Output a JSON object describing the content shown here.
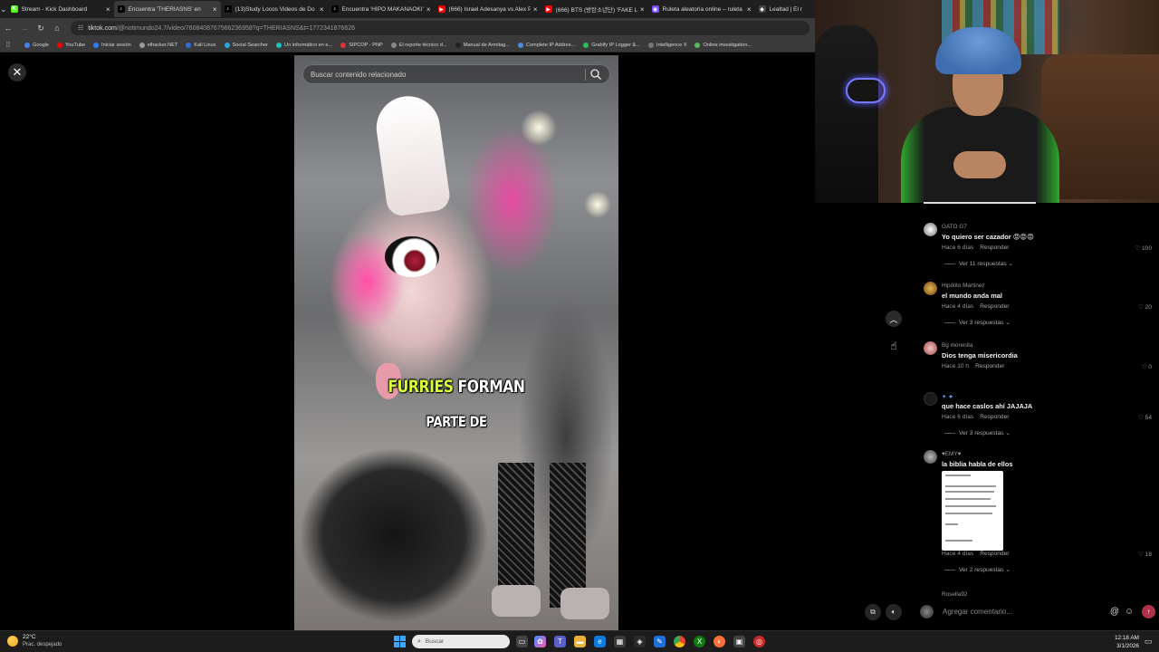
{
  "browser": {
    "tabs": [
      {
        "title": "Stream - Kick Dashboard",
        "favicon": "kick-icon",
        "color": "#53fc18",
        "glyph": "K",
        "active": false
      },
      {
        "title": "Encuentra 'THERIASNS' en",
        "favicon": "tiktok-icon",
        "color": "#000000",
        "glyph": "♪",
        "active": true
      },
      {
        "title": "(13)Study Locos Videos de Do",
        "favicon": "tiktok-icon",
        "color": "#000000",
        "glyph": "♪",
        "active": false
      },
      {
        "title": "Encuentra 'HIPO MAKANAOKI'",
        "favicon": "tiktok-icon",
        "color": "#000000",
        "glyph": "♪",
        "active": false
      },
      {
        "title": "(666) Israel Adesanya vs Alex Pe",
        "favicon": "youtube-icon",
        "color": "#ff0000",
        "glyph": "▶",
        "active": false
      },
      {
        "title": "(666) BTS (방탄소년단) 'FAKE LO",
        "favicon": "youtube-icon",
        "color": "#ff0000",
        "glyph": "▶",
        "active": false
      },
      {
        "title": "Ruleta aleatoria online – ruleta",
        "favicon": "wheel-icon",
        "color": "#7b4bff",
        "glyph": "◉",
        "active": false
      },
      {
        "title": "Lealtad | El r",
        "favicon": "diamond-icon",
        "color": "#444444",
        "glyph": "◆",
        "active": false
      }
    ],
    "address": {
      "domain": "tiktok.com",
      "path": "/@notimundo24.7/video/7608408767566236958?q=THERIASNS&t=1772341876626"
    },
    "bookmarks": [
      {
        "label": "Google",
        "color": "#4285f4"
      },
      {
        "label": "YouTube",
        "color": "#ff0000"
      },
      {
        "label": "Iniciar sesión",
        "color": "#2d7df6"
      },
      {
        "label": "elhacker.NET",
        "color": "#9a9a9a"
      },
      {
        "label": "Kali Linux",
        "color": "#2a6fdb"
      },
      {
        "label": "Social Searcher",
        "color": "#27a8e0"
      },
      {
        "label": "Un informático en e...",
        "color": "#19c2c2"
      },
      {
        "label": "SIPCOP - PNP",
        "color": "#d33"
      },
      {
        "label": "El reporte técnico d...",
        "color": "#888"
      },
      {
        "label": "Manual de Armitag...",
        "color": "#222"
      },
      {
        "label": "Complete IP Addres...",
        "color": "#4a90e2"
      },
      {
        "label": "Grabify IP Logger &...",
        "color": "#2ebd59"
      },
      {
        "label": "Intelligence X",
        "color": "#777"
      },
      {
        "label": "Online investigation...",
        "color": "#5cb85c"
      }
    ]
  },
  "tiktok": {
    "search_placeholder": "Buscar contenido relacionado",
    "caption_highlight": "FURRIES",
    "caption_rest": "FORMAN",
    "caption_line2": "PARTE DE",
    "comment_placeholder": "Agregar comentario...",
    "comments": [
      {
        "user": "GATO G7",
        "text": "Yo quiero ser cazador 😡😡😡",
        "time": "Hace 6 días",
        "reply": "Responder",
        "likes": "100",
        "replies": "Ver 11 respuestas",
        "avatar": "#d9d9d9"
      },
      {
        "user": "Hipólito Martinez",
        "text": "el mundo anda mal",
        "time": "Hace 4 días",
        "reply": "Responder",
        "likes": "20",
        "replies": "Ver 3 respuestas",
        "avatar": "#c79a3a"
      },
      {
        "user": "Bg morenita",
        "text": "Dios tenga misericordia",
        "time": "Hace 10 h",
        "reply": "Responder",
        "likes": "0",
        "replies": "",
        "avatar": "#d98a8a"
      },
      {
        "user": "✦ ★",
        "text": "que hace caslos ahí JAJAJA",
        "time": "Hace 6 días",
        "reply": "Responder",
        "likes": "54",
        "replies": "Ver 3 respuestas",
        "avatar": "#202020"
      },
      {
        "user": "♥EMY♥",
        "text": "la biblia habla de ellos",
        "time": "Hace 4 días",
        "reply": "Responder",
        "likes": "18",
        "replies": "Ver 2 respuestas",
        "avatar": "#8a8a8a"
      }
    ],
    "partial_user": "Rosella92"
  },
  "taskbar": {
    "temp": "22°C",
    "weather": "Prac. despejado",
    "search": "Buscar",
    "time": "12:18 AM",
    "date": "3/1/2026"
  }
}
